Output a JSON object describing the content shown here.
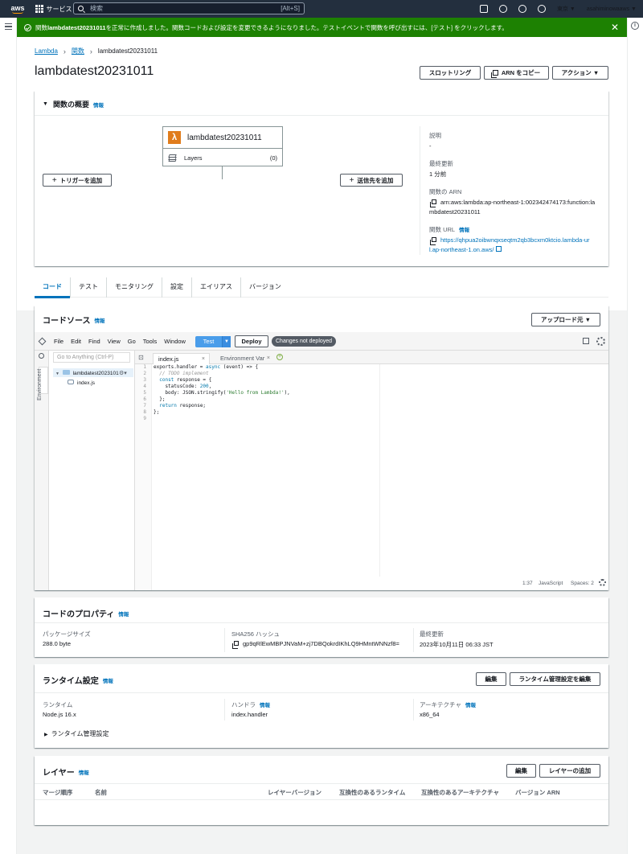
{
  "nav": {
    "logo": "aws",
    "services_label": "サービス",
    "search_placeholder": "検索",
    "search_shortcut": "[Alt+S]",
    "region": "東京 ▼",
    "user": "asahiminowaaws ▼"
  },
  "flash": {
    "message_prefix": "関数 ",
    "function_name": "lambdatest20231011",
    "message_suffix": " を正常に作成しました。関数コードおよび設定を変更できるようになりました。テストイベントで関数を呼び出すには、[テスト] をクリックします。",
    "close": "✕",
    "color": "#1d8102"
  },
  "breadcrumb": {
    "lambda": "Lambda",
    "functions": "関数",
    "current": "lambdatest20231011"
  },
  "page": {
    "title": "lambdatest20231011",
    "throttle_button": "スロットリング",
    "copy_arn_button": "ARN をコピー",
    "actions_button": "アクション ▼"
  },
  "overview": {
    "title": "関数の概要",
    "info": "情報",
    "function_name": "lambdatest20231011",
    "layers_label": "Layers",
    "layers_count": "(0)",
    "add_trigger": "トリガーを追加",
    "add_destination": "送信先を追加",
    "description_label": "説明",
    "description_value": "-",
    "last_modified_label": "最終更新",
    "last_modified_value": "1 分前",
    "arn_label": "関数の ARN",
    "arn_line1": "arn:aws:lambda:ap-northeast-1:002342474173:function:la",
    "arn_line2": "mbdatest20231011",
    "url_label": "関数 URL",
    "url_info": "情報",
    "url_line1": "https://qhpua2oibwnqxseqtm2qb3bcxm0ktcio.lambda-ur",
    "url_line2": "l.ap-northeast-1.on.aws/"
  },
  "tabs": [
    "コード",
    "テスト",
    "モニタリング",
    "設定",
    "エイリアス",
    "バージョン"
  ],
  "code_source": {
    "title": "コードソース",
    "info": "情報",
    "upload_button": "アップロード元 ▼",
    "menu": [
      "File",
      "Edit",
      "Find",
      "View",
      "Go",
      "Tools",
      "Window"
    ],
    "test": "Test",
    "deploy": "Deploy",
    "changes_badge": "Changes not deployed",
    "goto_placeholder": "Go to Anything (Ctrl-P)",
    "environment": "Environment",
    "folder": "lambdatest2023101",
    "file": "index.js",
    "editor_tabs": [
      "index.js",
      "Environment Var"
    ],
    "line_numbers": [
      "1",
      "2",
      "3",
      "4",
      "5",
      "6",
      "7",
      "8",
      "9"
    ],
    "status_position": "1:37",
    "status_language": "JavaScript",
    "status_spaces": "Spaces: 2"
  },
  "code_properties": {
    "title": "コードのプロパティ",
    "info": "情報",
    "package_size_label": "パッケージサイズ",
    "package_size_value": "288.0 byte",
    "sha_label": "SHA256 ハッシュ",
    "sha_value": "gp9qRlEwMBPJNVaM+zj7DBQokrdIKhLQ9HMntWNNzf8=",
    "last_modified_label": "最終更新",
    "last_modified_value": "2023年10月11日 06:33 JST"
  },
  "runtime": {
    "title": "ランタイム設定",
    "info": "情報",
    "edit_button": "編集",
    "edit_mgmt_button": "ランタイム管理設定を編集",
    "runtime_label": "ランタイム",
    "runtime_value": "Node.js 16.x",
    "handler_label": "ハンドラ",
    "handler_info": "情報",
    "handler_value": "index.handler",
    "arch_label": "アーキテクチャ",
    "arch_info": "情報",
    "arch_value": "x86_64",
    "mgmt_toggle": "ランタイム管理設定"
  },
  "layers": {
    "title": "レイヤー",
    "info": "情報",
    "edit_button": "編集",
    "add_button": "レイヤーの追加",
    "columns": [
      "マージ順序",
      "名前",
      "レイヤーバージョン",
      "互換性のあるランタイム",
      "互換性のあるアーキテクチャ",
      "バージョン ARN"
    ]
  }
}
